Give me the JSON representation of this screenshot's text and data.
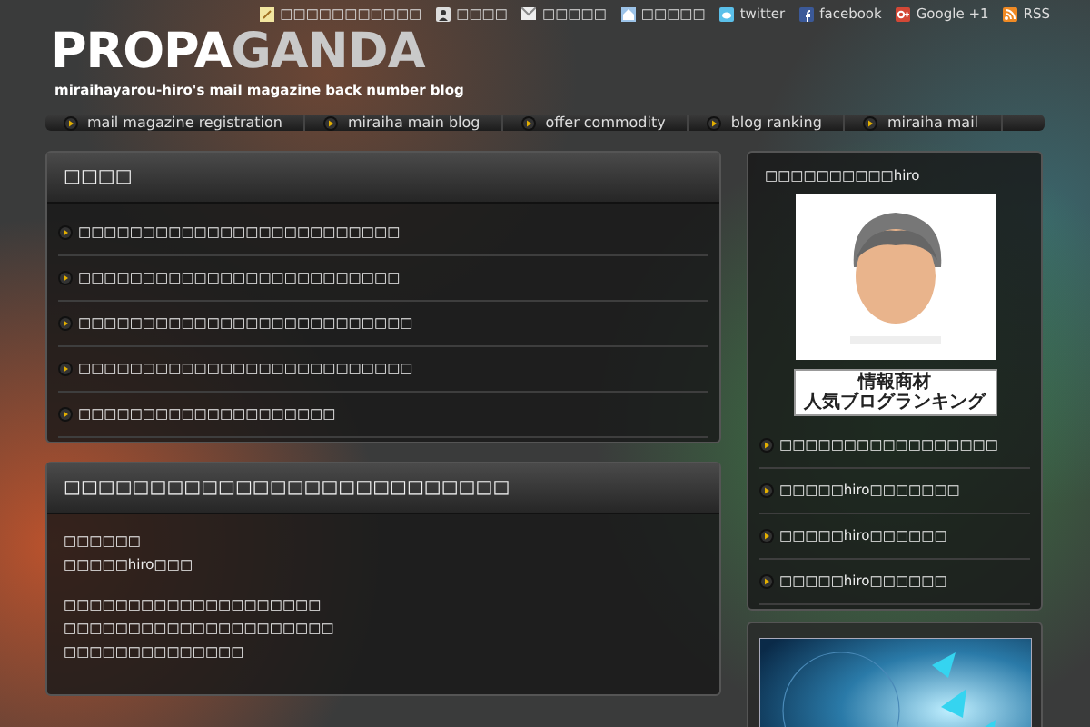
{
  "header_links": [
    {
      "kind": "note",
      "label": "□□□□□□□□□□□"
    },
    {
      "kind": "person",
      "label": "□□□□"
    },
    {
      "kind": "mail",
      "label": "□□□□□"
    },
    {
      "kind": "home",
      "label": "□□□□□"
    },
    {
      "kind": "twitter",
      "label": "twitter"
    },
    {
      "kind": "facebook",
      "label": "facebook"
    },
    {
      "kind": "google",
      "label": "Google +1"
    },
    {
      "kind": "rss",
      "label": "RSS"
    }
  ],
  "logo": {
    "parts": [
      "PROPA",
      "GANDA"
    ],
    "tagline": "miraihayarou-hiro's mail magazine back number blog"
  },
  "nav": [
    "mail magazine registration",
    "miraiha main blog",
    "offer commodity",
    "blog ranking",
    "miraiha mail"
  ],
  "recent": {
    "title": "□□□□",
    "items": [
      "□□□□□□□□□□□□□□□□□□□□□□□□□",
      "□□□□□□□□□□□□□□□□□□□□□□□□□",
      "□□□□□□□□□□□□□□□□□□□□□□□□□□",
      "□□□□□□□□□□□□□□□□□□□□□□□□□□",
      "□□□□□□□□□□□□□□□□□□□□"
    ]
  },
  "article": {
    "title": "□□□□□□□□□□□□□□□□□□□□□□□□□□",
    "paragraphs": [
      [
        "□□□□□□",
        "□□□□□hiro□□□"
      ],
      [
        "□□□□□□□□□□□□□□□□□□□□",
        "□□□□□□□□□□□□□□□□□□□□□",
        "□□□□□□□□□□□□□□"
      ]
    ]
  },
  "profile": {
    "title": "□□□□□□□□□□hiro",
    "avatar": {
      "kind": "picture"
    },
    "ranking_badge": [
      "情報商材",
      "人気ブログランキング"
    ],
    "items": [
      "□□□□□□□□□□□□□□□□□",
      "□□□□□hiro□□□□□□□",
      "□□□□□hiro□□□□□□",
      "□□□□□hiro□□□□□□"
    ]
  },
  "promo": {
    "kind": "picture"
  }
}
